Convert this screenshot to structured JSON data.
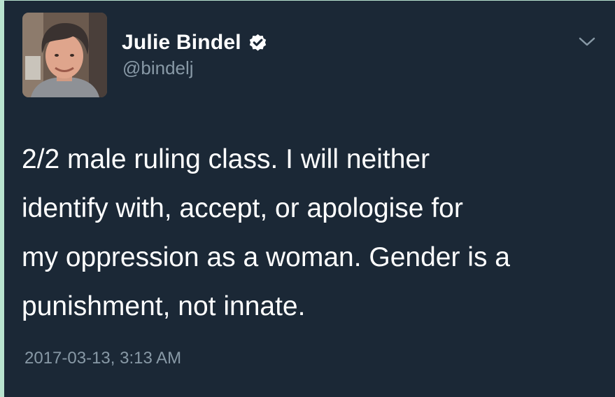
{
  "tweet": {
    "author": {
      "display_name": "Julie Bindel",
      "handle": "@bindelj",
      "verified": true
    },
    "text": "2/2 male ruling class. I will neither\nidentify with, accept, or apologise for\nmy oppression as a woman. Gender is a\npunishment, not innate.",
    "timestamp": "2017-03-13, 3:13 AM"
  },
  "icons": {
    "verified": "verified-badge-icon",
    "menu": "chevron-down-icon"
  },
  "colors": {
    "background": "#1b2836",
    "text_primary": "#ffffff",
    "text_secondary": "#8899a6",
    "page_border": "#b9e3cf"
  }
}
